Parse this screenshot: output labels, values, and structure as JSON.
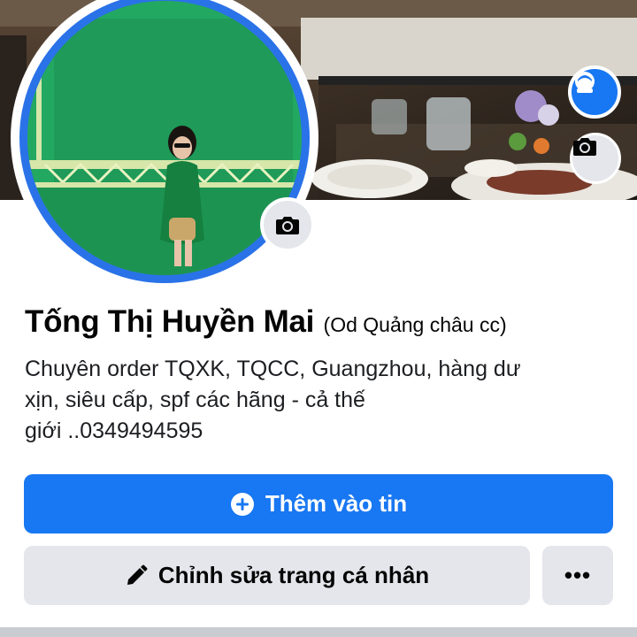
{
  "profile": {
    "name": "Tống Thị Huyền Mai",
    "alternate_name": "(Od Quảng châu cc)",
    "bio_lines": [
      "Chuyên order TQXK, TQCC, Guangzhou, hàng dư",
      "xịn, siêu cấp, spf các hãng - cả thế",
      "giới ..0349494595"
    ]
  },
  "actions": {
    "add_story_label": "Thêm vào tin",
    "edit_profile_label": "Chỉnh sửa trang cá nhân",
    "more_label": "•••"
  },
  "icons": {
    "avatar_badge": "avatar-icon",
    "cover_camera": "camera-icon",
    "profile_camera": "camera-icon",
    "add": "plus-circle-icon",
    "edit": "pencil-icon"
  },
  "colors": {
    "primary": "#1877f2",
    "secondary_button": "#e4e6eb",
    "text": "#050505"
  }
}
